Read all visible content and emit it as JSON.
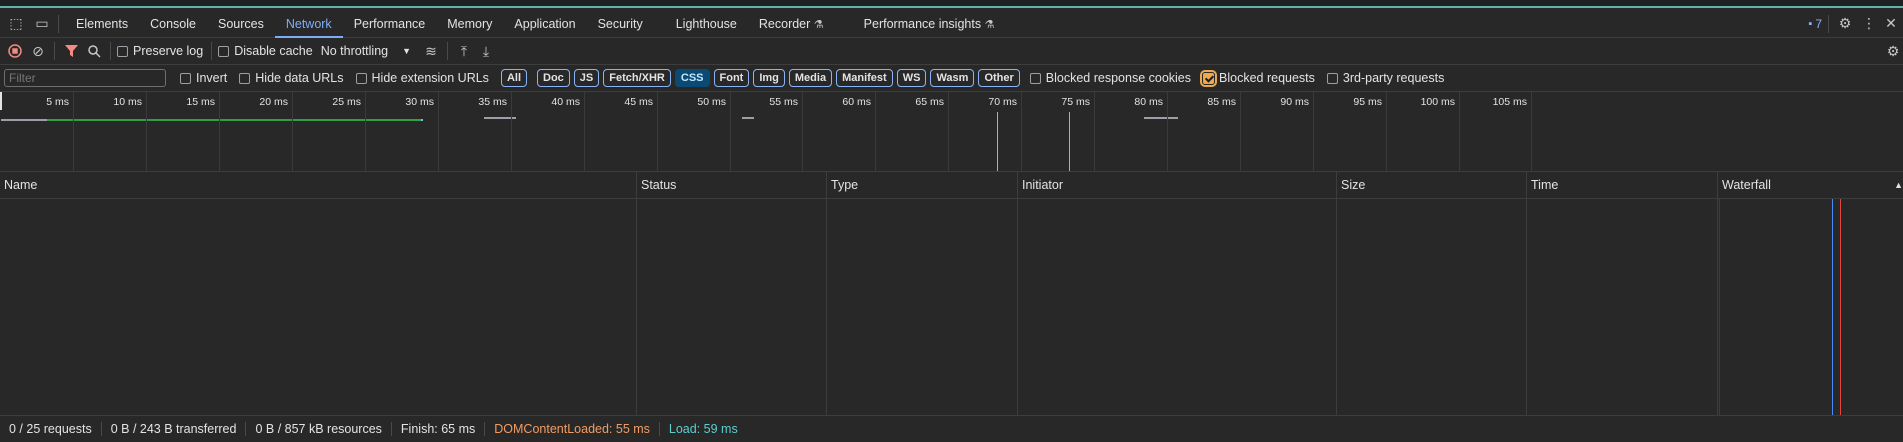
{
  "tabs": [
    "Elements",
    "Console",
    "Sources",
    "Network",
    "Performance",
    "Memory",
    "Application",
    "Security",
    "Lighthouse",
    "Recorder",
    "Performance insights"
  ],
  "issues_count": "7",
  "toolbar": {
    "preserve_log": "Preserve log",
    "disable_cache": "Disable cache",
    "throttling": "No throttling"
  },
  "filter": {
    "placeholder": "Filter",
    "invert": "Invert",
    "hide_data_urls": "Hide data URLs",
    "hide_extension_urls": "Hide extension URLs",
    "types": [
      "All",
      "Doc",
      "JS",
      "Fetch/XHR",
      "CSS",
      "Font",
      "Img",
      "Media",
      "Manifest",
      "WS",
      "Wasm",
      "Other"
    ],
    "selected_type": "CSS",
    "blocked_response_cookies": "Blocked response cookies",
    "blocked_requests": "Blocked requests",
    "third_party_requests": "3rd-party requests"
  },
  "timeline": {
    "ticks_ms": [
      5,
      10,
      15,
      20,
      25,
      30,
      35,
      40,
      45,
      50,
      55,
      60,
      65,
      70,
      75,
      80,
      85,
      90,
      95,
      100,
      105
    ],
    "tick_labels": [
      "5 ms",
      "10 ms",
      "15 ms",
      "20 ms",
      "25 ms",
      "30 ms",
      "35 ms",
      "40 ms",
      "45 ms",
      "50 ms",
      "55 ms",
      "60 ms",
      "65 ms",
      "70 ms",
      "75 ms",
      "80 ms",
      "85 ms",
      "90 ms",
      "95 ms",
      "100 ms",
      "105 ms"
    ]
  },
  "columns": [
    "Name",
    "Status",
    "Type",
    "Initiator",
    "Size",
    "Time",
    "Waterfall"
  ],
  "status": {
    "requests": "0 / 25 requests",
    "transferred": "0 B / 243 B transferred",
    "resources": "0 B / 857 kB resources",
    "finish": "Finish: 65 ms",
    "dom_content_loaded": "DOMContentLoaded: 55 ms",
    "load": "Load: 59 ms"
  },
  "colors": {
    "accent": "#7cacf8",
    "dcl": "#f29c64",
    "load": "#5ccfcf",
    "checked": "#f0a84c"
  }
}
